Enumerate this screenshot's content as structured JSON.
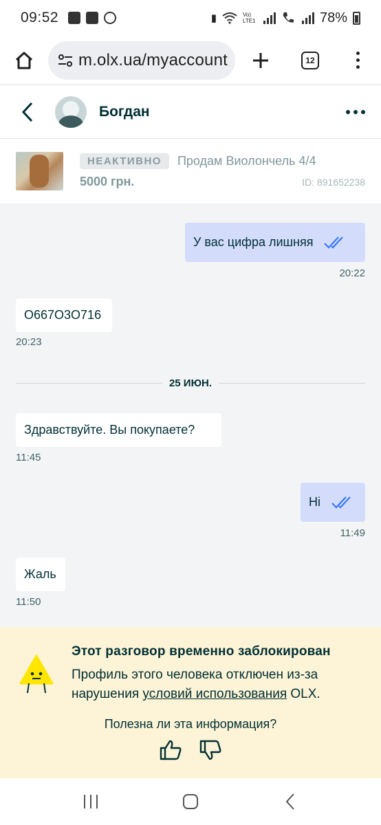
{
  "status_bar": {
    "time": "09:52",
    "battery": "78%",
    "network": "Vo) LTE1"
  },
  "browser": {
    "url": "m.olx.ua/myaccount",
    "tab_count": "12"
  },
  "chat": {
    "contact_name": "Богдан"
  },
  "ad": {
    "status_badge": "НЕАКТИВНО",
    "title": "Продам Виолончель 4/4",
    "price": "5000 грн.",
    "id_text": "ID: 891652238"
  },
  "messages": [
    {
      "direction": "out",
      "text": "У вас цифра лишняя",
      "time": "20:22",
      "read": true
    },
    {
      "direction": "in",
      "text": "O667O3O716",
      "time": "20:23"
    },
    {
      "direction": "in",
      "text": "Здравствуйте. Вы покупаете?",
      "time": "11:45"
    },
    {
      "direction": "out",
      "text": "Ні",
      "time": "11:49",
      "read": true
    },
    {
      "direction": "in",
      "text": "Жаль",
      "time": "11:50"
    }
  ],
  "date_divider": "25 ИЮН.",
  "notice": {
    "title": "Этот разговор временно заблокирован",
    "body_before": "Профиль этого человека отключен из-за нарушения ",
    "body_link": "условий использования",
    "body_after": " OLX.",
    "question": "Полезна ли эта информация?"
  },
  "colors": {
    "outgoing_bubble": "#d3dcfb",
    "incoming_bubble": "#ffffff",
    "chat_background": "#f2f4f5",
    "notice_background": "#fdf3d6",
    "read_ticks": "#3a77ff",
    "text_primary": "#002f34"
  },
  "icons": {
    "home": "home-icon",
    "site_settings": "tune-icon",
    "new_tab": "plus-icon",
    "menu": "more-vertical-icon",
    "back": "chevron-left-icon",
    "more": "more-horizontal-icon",
    "read": "double-check-icon",
    "warning": "warning-face-icon",
    "like": "thumbs-up-icon",
    "dislike": "thumbs-down-icon"
  }
}
